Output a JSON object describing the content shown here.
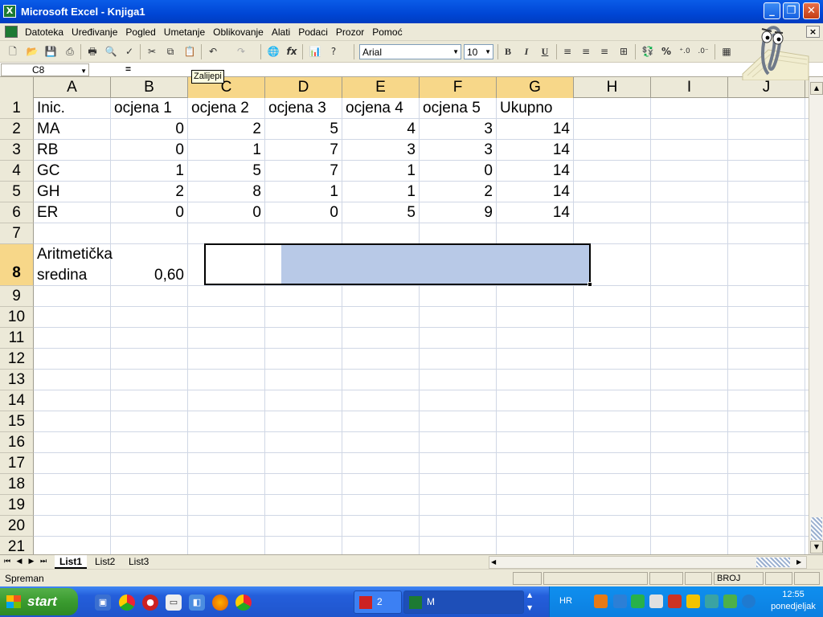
{
  "window": {
    "title": "Microsoft Excel - Knjiga1",
    "buttons": {
      "minimize": "_",
      "restore": "❐",
      "close": "✕"
    }
  },
  "menu": {
    "items": [
      "Datoteka",
      "Uređivanje",
      "Pogled",
      "Umetanje",
      "Oblikovanje",
      "Alati",
      "Podaci",
      "Prozor",
      "Pomoć"
    ]
  },
  "toolbar": {
    "font": "Arial",
    "size": "10",
    "bold": "B",
    "italic": "I",
    "underline": "U",
    "percent": "%",
    "fx": "fx"
  },
  "formula_bar": {
    "name_box": "C8",
    "equals": "=",
    "value": ""
  },
  "tooltip": "Zalijepi",
  "grid": {
    "columns": [
      "A",
      "B",
      "C",
      "D",
      "E",
      "F",
      "G",
      "H",
      "I",
      "J"
    ],
    "rows": [
      "1",
      "2",
      "3",
      "4",
      "5",
      "6",
      "7",
      "8",
      "9",
      "10",
      "11",
      "12",
      "13",
      "14",
      "15",
      "16",
      "17",
      "18",
      "19",
      "20",
      "21"
    ],
    "header_row": [
      "Inic.",
      "ocjena 1",
      "ocjena 2",
      "ocjena 3",
      "ocjena 4",
      "ocjena 5",
      "Ukupno"
    ],
    "data_rows": [
      [
        "MA",
        "0",
        "2",
        "5",
        "4",
        "3",
        "14"
      ],
      [
        "RB",
        "0",
        "1",
        "7",
        "3",
        "3",
        "14"
      ],
      [
        "GC",
        "1",
        "5",
        "7",
        "1",
        "0",
        "14"
      ],
      [
        "GH",
        "2",
        "8",
        "1",
        "1",
        "2",
        "14"
      ],
      [
        "ER",
        "0",
        "0",
        "0",
        "5",
        "9",
        "14"
      ]
    ],
    "row8": {
      "a_line1": "Aritmetička",
      "a_line2": "sredina",
      "b": "0,60"
    },
    "selection": "C8:G8",
    "active_cell": "C8"
  },
  "sheets": {
    "tabs": [
      "List1",
      "List2",
      "List3"
    ],
    "active": "List1"
  },
  "status": {
    "text": "Spreman",
    "indicator": "BROJ"
  },
  "taskbar": {
    "start": "start",
    "tasks": [
      {
        "label": "2"
      },
      {
        "label": "M"
      }
    ],
    "language": "HR",
    "clock_time": "12:55",
    "clock_day": "ponedjeljak"
  },
  "colors": {
    "title_blue": "#0046d5",
    "selection_fill": "#b8c9e7",
    "header_selected": "#f7d789",
    "gridline": "#d0d7e5"
  }
}
